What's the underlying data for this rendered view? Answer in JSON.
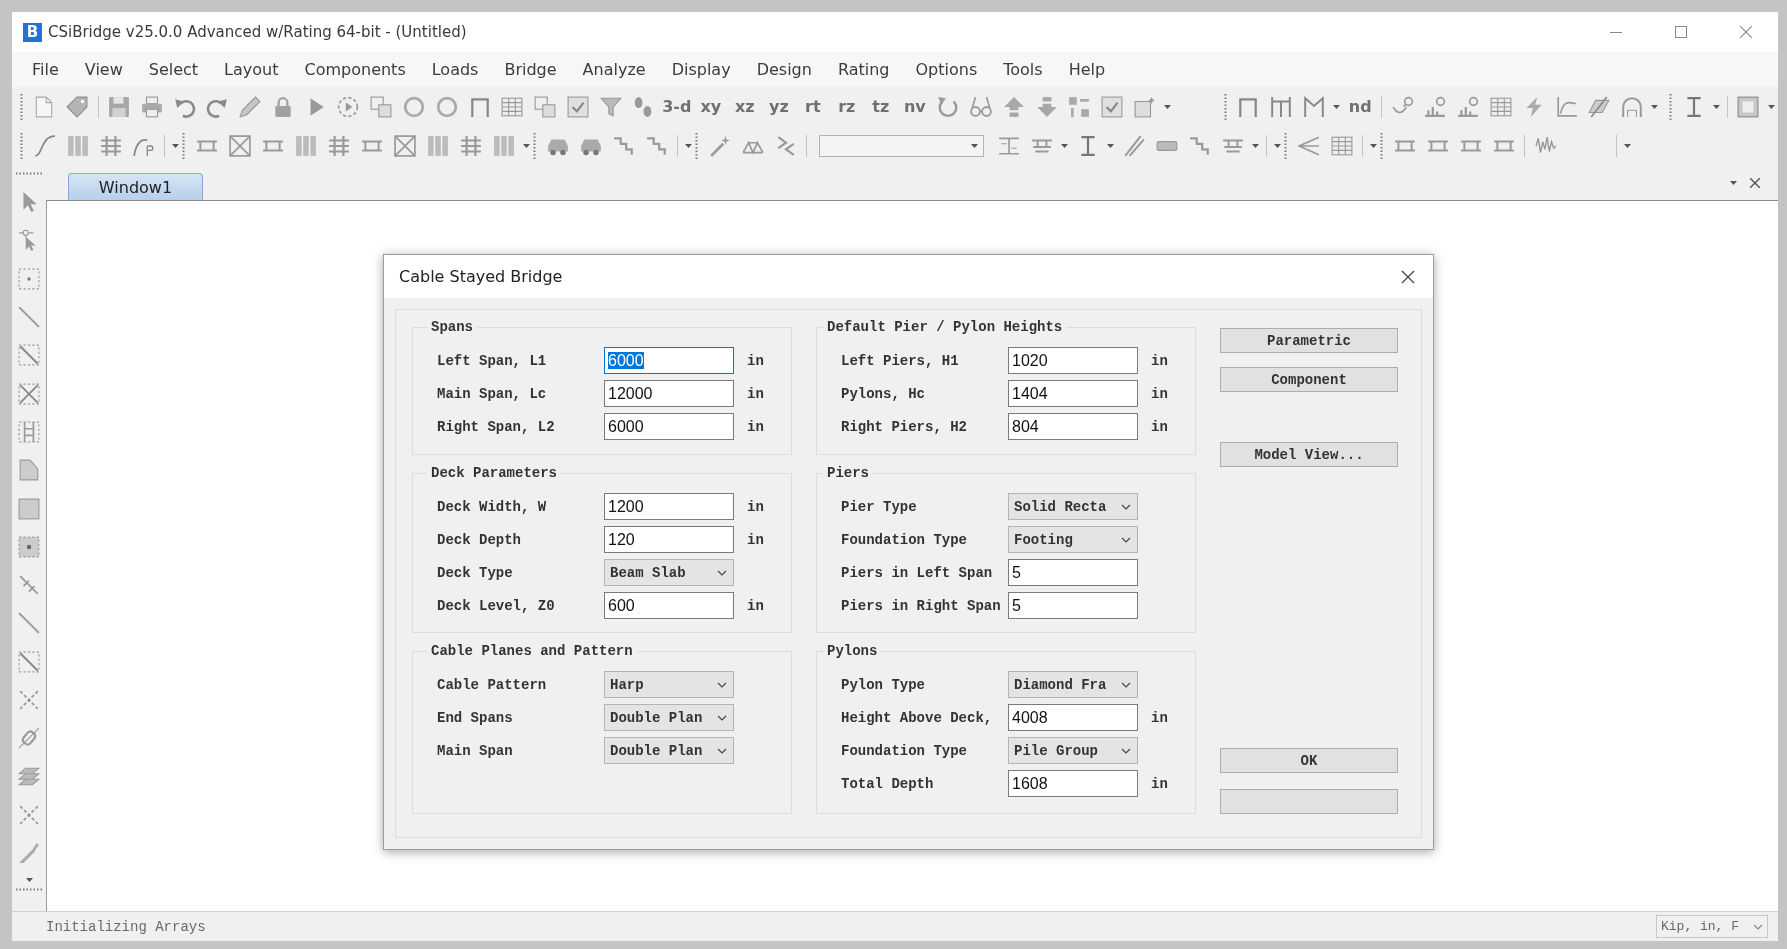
{
  "window": {
    "logo_letter": "B",
    "title": "CSiBridge v25.0.0 Advanced w/Rating 64-bit - (Untitled)"
  },
  "menu": [
    "File",
    "View",
    "Select",
    "Layout",
    "Components",
    "Loads",
    "Bridge",
    "Analyze",
    "Display",
    "Design",
    "Rating",
    "Options",
    "Tools",
    "Help"
  ],
  "toolbar": {
    "view_buttons": [
      "3-d",
      "xy",
      "xz",
      "yz",
      "rt",
      "rz",
      "tz",
      "nv"
    ],
    "node_button": "nd"
  },
  "tabs": [
    {
      "label": "Window1",
      "selected": true
    }
  ],
  "dialog": {
    "title": "Cable Stayed Bridge",
    "groups": [
      {
        "title": "Spans",
        "rows": [
          {
            "kind": "text",
            "label": "Left Span, L1",
            "value": "6000",
            "unit": "in",
            "focused": true
          },
          {
            "kind": "text",
            "label": "Main Span, Lc",
            "value": "12000",
            "unit": "in",
            "focused": false
          },
          {
            "kind": "text",
            "label": "Right Span, L2",
            "value": "6000",
            "unit": "in",
            "focused": false
          }
        ]
      },
      {
        "title": "Default Pier / Pylon Heights",
        "rows": [
          {
            "kind": "text",
            "label": "Left Piers, H1",
            "value": "1020",
            "unit": "in",
            "focused": false
          },
          {
            "kind": "text",
            "label": "Pylons, Hc",
            "value": "1404",
            "unit": "in",
            "focused": false
          },
          {
            "kind": "text",
            "label": "Right Piers, H2",
            "value": "804",
            "unit": "in",
            "focused": false
          }
        ]
      },
      {
        "title": "Deck Parameters",
        "rows": [
          {
            "kind": "text",
            "label": "Deck Width, W",
            "value": "1200",
            "unit": "in",
            "focused": false
          },
          {
            "kind": "text",
            "label": "Deck Depth",
            "value": "120",
            "unit": "in",
            "focused": false
          },
          {
            "kind": "dropdown",
            "label": "Deck Type",
            "value": "Beam Slab",
            "focused": false
          },
          {
            "kind": "text",
            "label": "Deck Level, Z0",
            "value": "600",
            "unit": "in",
            "focused": false
          }
        ]
      },
      {
        "title": "Piers",
        "rows": [
          {
            "kind": "dropdown",
            "label": "Pier Type",
            "value": "Solid Recta",
            "focused": false
          },
          {
            "kind": "dropdown",
            "label": "Foundation Type",
            "value": "Footing",
            "focused": false
          },
          {
            "kind": "text",
            "label": "Piers in Left Span",
            "value": "5",
            "focused": false
          },
          {
            "kind": "text",
            "label": "Piers in Right Span",
            "value": "5",
            "focused": false
          }
        ]
      },
      {
        "title": "Cable Planes and Pattern",
        "rows": [
          {
            "kind": "dropdown",
            "label": "Cable Pattern",
            "value": "Harp",
            "focused": false
          },
          {
            "kind": "dropdown",
            "label": "End Spans",
            "value": "Double Plan",
            "focused": false
          },
          {
            "kind": "dropdown",
            "label": "Main Span",
            "value": "Double Plan",
            "focused": false
          }
        ]
      },
      {
        "title": "Pylons",
        "rows": [
          {
            "kind": "dropdown",
            "label": "Pylon Type",
            "value": "Diamond Fra",
            "focused": false
          },
          {
            "kind": "text",
            "label": "Height Above Deck,",
            "value": "4008",
            "unit": "in",
            "focused": false
          },
          {
            "kind": "dropdown",
            "label": "Foundation Type",
            "value": "Pile Group",
            "focused": false
          },
          {
            "kind": "text",
            "label": "Total Depth",
            "value": "1608",
            "unit": "in",
            "focused": false
          }
        ]
      }
    ],
    "side_buttons": [
      "Parametric",
      "Component"
    ],
    "view_button": "Model View...",
    "action_buttons": [
      {
        "kind": "labeled",
        "label": "OK"
      },
      {
        "kind": "blank"
      }
    ]
  },
  "status_bar": {
    "message": "Initializing Arrays",
    "units": "Kip, in, F"
  }
}
